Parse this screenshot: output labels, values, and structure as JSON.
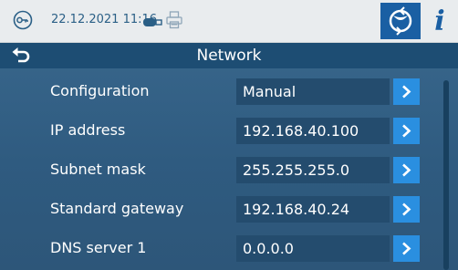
{
  "status_bar": {
    "datetime": "22.12.2021 11:16",
    "icons": [
      "key-icon",
      "usb-icon",
      "printer-icon",
      "sync-icon",
      "info-icon"
    ],
    "info_label": "i"
  },
  "header": {
    "title": "Network",
    "back_icon": "back-arrow-icon"
  },
  "settings": [
    {
      "label": "Configuration",
      "value": "Manual"
    },
    {
      "label": "IP address",
      "value": "192.168.40.100"
    },
    {
      "label": "Subnet mask",
      "value": "255.255.255.0"
    },
    {
      "label": "Standard gateway",
      "value": "192.168.40.24"
    },
    {
      "label": "DNS server 1",
      "value": "0.0.0.0"
    }
  ],
  "colors": {
    "background": "#2f5b80",
    "title_bar": "#1d4d73",
    "status_bar": "#e9ecee",
    "accent_button": "#2a8fe0",
    "sync_button": "#1a5fa3",
    "value_box": "#244c6e"
  }
}
